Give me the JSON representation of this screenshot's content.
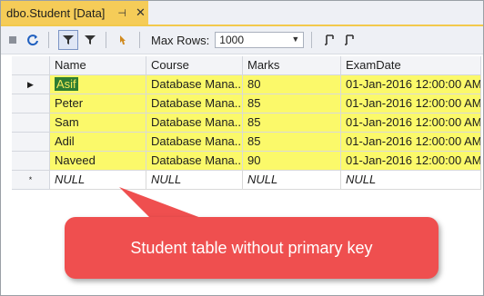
{
  "tab": {
    "title": "dbo.Student [Data]",
    "pin": "⊣",
    "close": "✕"
  },
  "toolbar": {
    "max_rows_label": "Max Rows:",
    "max_rows_value": "1000",
    "icons": [
      "stop-icon",
      "refresh-icon",
      "filter-pane-icon",
      "filter-icon",
      "sql-pane-icon",
      "script-icon",
      "script-data-icon"
    ]
  },
  "grid": {
    "columns": [
      "Name",
      "Course",
      "Marks",
      "ExamDate"
    ],
    "rows": [
      {
        "marker": "▶",
        "cells": [
          "Asif",
          "Database Mana...",
          "80",
          "01-Jan-2016 12:00:00 AM"
        ]
      },
      {
        "marker": "",
        "cells": [
          "Peter",
          "Database Mana...",
          "85",
          "01-Jan-2016 12:00:00 AM"
        ]
      },
      {
        "marker": "",
        "cells": [
          "Sam",
          "Database Mana...",
          "85",
          "01-Jan-2016 12:00:00 AM"
        ]
      },
      {
        "marker": "",
        "cells": [
          "Adil",
          "Database Mana...",
          "85",
          "01-Jan-2016 12:00:00 AM"
        ]
      },
      {
        "marker": "",
        "cells": [
          "Naveed",
          "Database Mana...",
          "90",
          "01-Jan-2016 12:00:00 AM"
        ]
      }
    ],
    "new_row": {
      "marker": "*",
      "cells": [
        "NULL",
        "NULL",
        "NULL",
        "NULL"
      ]
    }
  },
  "callout": {
    "text": "Student table without primary key"
  },
  "colors": {
    "tab_accent": "#f5cc58",
    "row_highlight": "#fbf96a",
    "callout": "#ef4f4f"
  }
}
